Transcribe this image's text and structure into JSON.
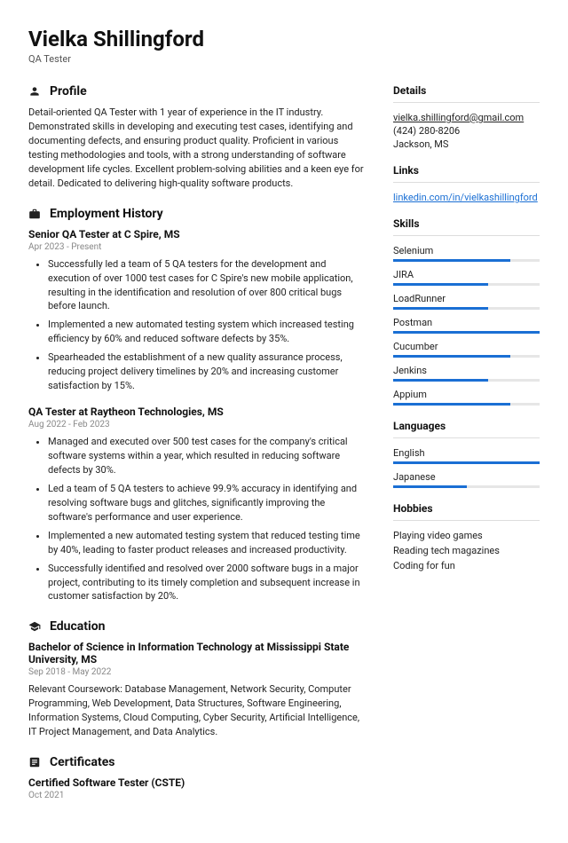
{
  "header": {
    "name": "Vielka Shillingford",
    "title": "QA Tester"
  },
  "profile": {
    "heading": "Profile",
    "text": "Detail-oriented QA Tester with 1 year of experience in the IT industry. Demonstrated skills in developing and executing test cases, identifying and documenting defects, and ensuring product quality. Proficient in various testing methodologies and tools, with a strong understanding of software development life cycles. Excellent problem-solving abilities and a keen eye for detail. Dedicated to delivering high-quality software products."
  },
  "employment": {
    "heading": "Employment History",
    "jobs": [
      {
        "title": "Senior QA Tester at C Spire, MS",
        "dates": "Apr 2023 - Present",
        "bullets": [
          "Successfully led a team of 5 QA testers for the development and execution of over 1000 test cases for C Spire's new mobile application, resulting in the identification and resolution of over 800 critical bugs before launch.",
          "Implemented a new automated testing system which increased testing efficiency by 60% and reduced software defects by 35%.",
          "Spearheaded the establishment of a new quality assurance process, reducing project delivery timelines by 20% and increasing customer satisfaction by 15%."
        ]
      },
      {
        "title": "QA Tester at Raytheon Technologies, MS",
        "dates": "Aug 2022 - Feb 2023",
        "bullets": [
          "Managed and executed over 500 test cases for the company's critical software systems within a year, which resulted in reducing software defects by 30%.",
          "Led a team of 5 QA testers to achieve 99.9% accuracy in identifying and resolving software bugs and glitches, significantly improving the software's performance and user experience.",
          "Implemented a new automated testing system that reduced testing time by 40%, leading to faster product releases and increased productivity.",
          "Successfully identified and resolved over 2000 software bugs in a major project, contributing to its timely completion and subsequent increase in customer satisfaction by 20%."
        ]
      }
    ]
  },
  "education": {
    "heading": "Education",
    "degree": "Bachelor of Science in Information Technology at Mississippi State University, MS",
    "dates": "Sep 2018 - May 2022",
    "coursework": "Relevant Coursework: Database Management, Network Security, Computer Programming, Web Development, Data Structures, Software Engineering, Information Systems, Cloud Computing, Cyber Security, Artificial Intelligence, IT Project Management, and Data Analytics."
  },
  "certificates": {
    "heading": "Certificates",
    "items": [
      {
        "title": "Certified Software Tester (CSTE)",
        "dates": "Oct 2021"
      }
    ]
  },
  "details": {
    "heading": "Details",
    "email": "vielka.shillingford@gmail.com",
    "phone": "(424) 280-8206",
    "location": "Jackson, MS"
  },
  "links": {
    "heading": "Links",
    "items": [
      "linkedin.com/in/vielkashillingford"
    ]
  },
  "skills": {
    "heading": "Skills",
    "items": [
      {
        "name": "Selenium",
        "level": 80
      },
      {
        "name": "JIRA",
        "level": 65
      },
      {
        "name": "LoadRunner",
        "level": 65
      },
      {
        "name": "Postman",
        "level": 100
      },
      {
        "name": "Cucumber",
        "level": 80
      },
      {
        "name": "Jenkins",
        "level": 65
      },
      {
        "name": "Appium",
        "level": 80
      }
    ]
  },
  "languages": {
    "heading": "Languages",
    "items": [
      {
        "name": "English",
        "level": 100
      },
      {
        "name": "Japanese",
        "level": 50
      }
    ]
  },
  "hobbies": {
    "heading": "Hobbies",
    "items": [
      "Playing video games",
      "Reading tech magazines",
      "Coding for fun"
    ]
  }
}
